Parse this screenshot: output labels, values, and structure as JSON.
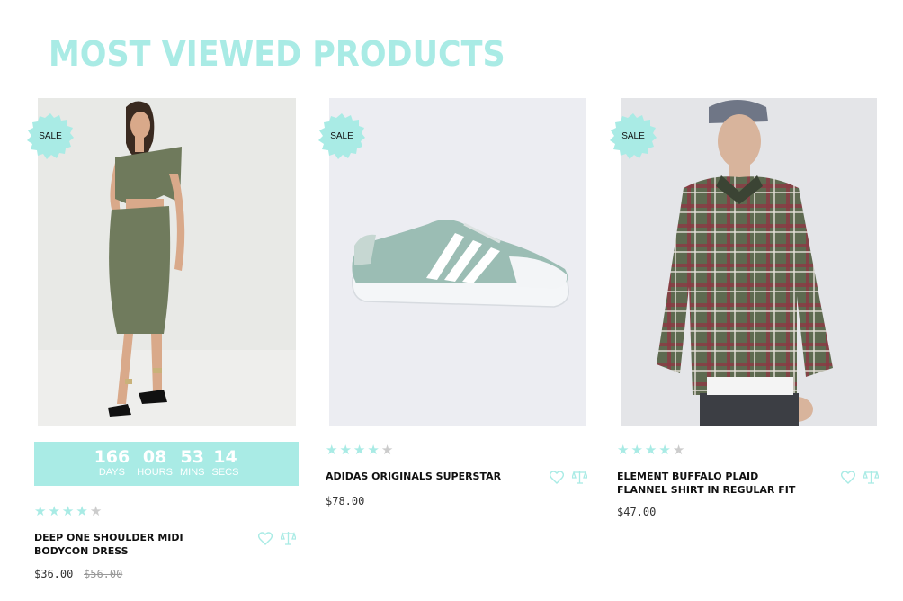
{
  "section": {
    "title": "MOST VIEWED PRODUCTS"
  },
  "colors": {
    "accent": "#a9ebe5",
    "star_off": "#cccccc"
  },
  "products": [
    {
      "badge": "SALE",
      "name": "DEEP ONE SHOULDER MIDI BODYCON DRESS",
      "price": "$36.00",
      "old_price": "$56.00",
      "rating": 4,
      "image": "olive-dress-model",
      "countdown": {
        "days": "166",
        "days_label": "DAYS",
        "hours": "08",
        "hours_label": "HOURS",
        "mins": "53",
        "mins_label": "MINS",
        "secs": "14",
        "secs_label": "SECS"
      }
    },
    {
      "badge": "SALE",
      "name": "ADIDAS ORIGINALS SUPERSTAR",
      "price": "$78.00",
      "rating": 4,
      "image": "mint-sneaker"
    },
    {
      "badge": "SALE",
      "name": "ELEMENT BUFFALO PLAID FLANNEL SHIRT IN REGULAR FIT",
      "price": "$47.00",
      "rating": 4,
      "image": "plaid-shirt-model"
    }
  ],
  "icons": {
    "wishlist": "heart-icon",
    "compare": "scale-icon"
  }
}
